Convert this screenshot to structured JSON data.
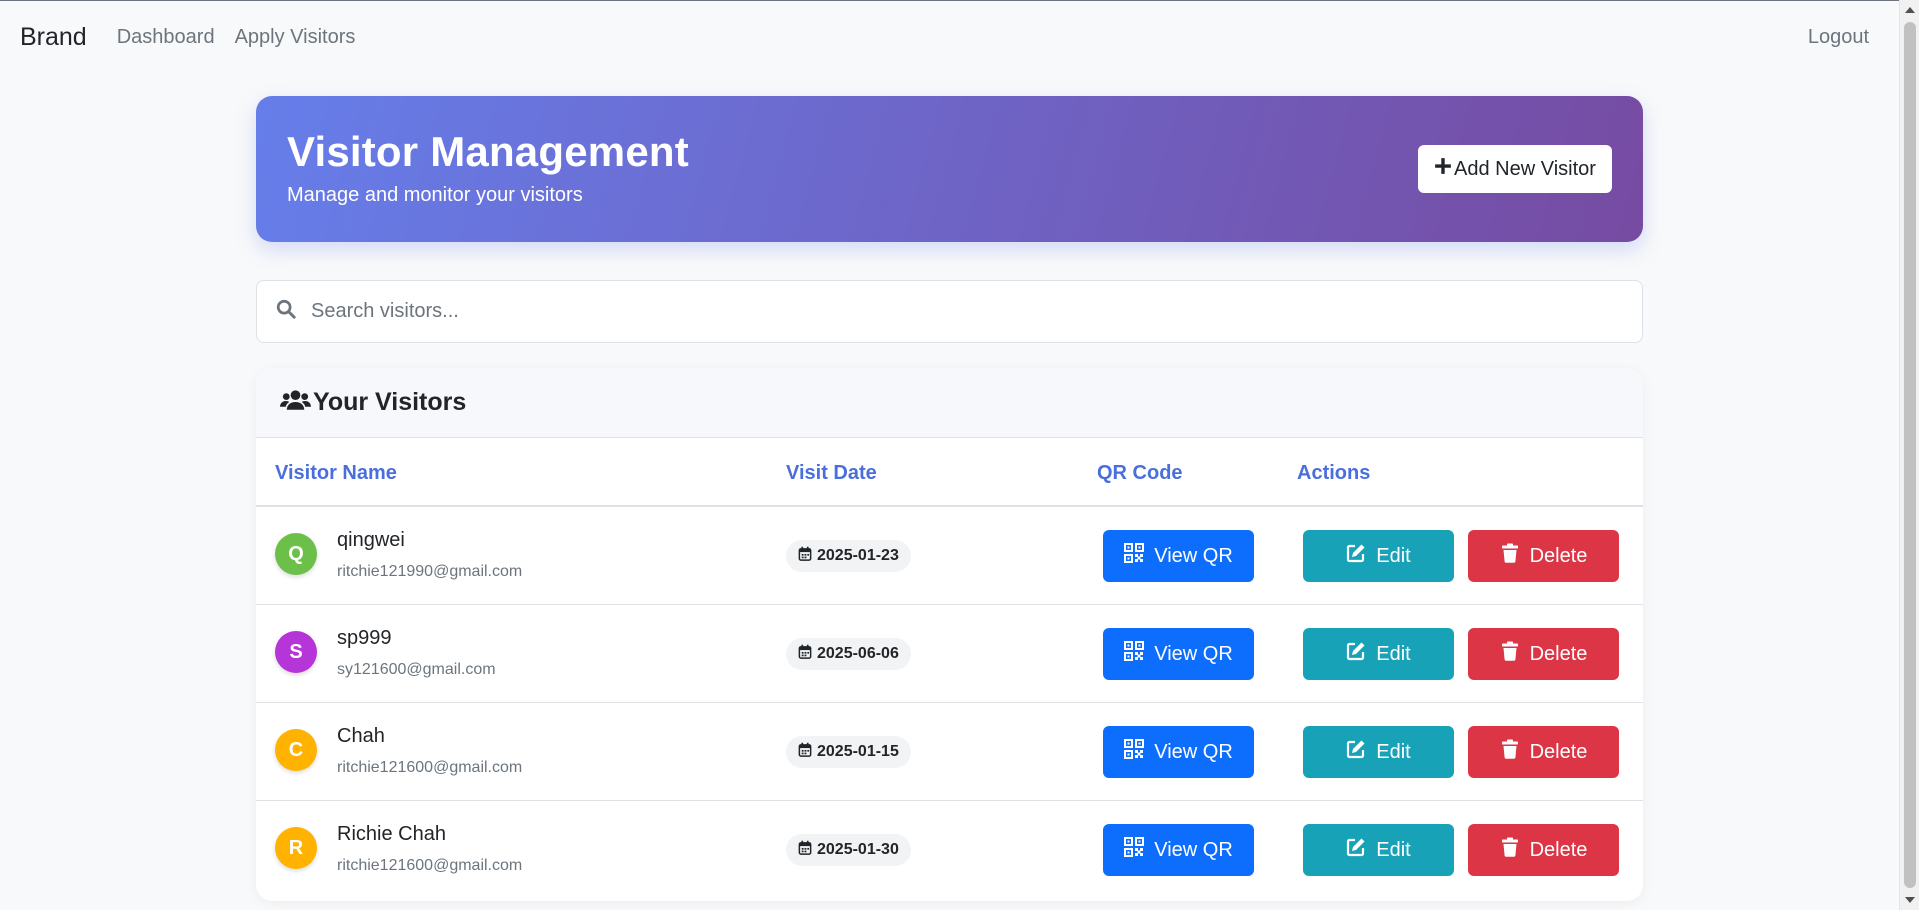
{
  "nav": {
    "brand": "Brand",
    "links": [
      "Dashboard",
      "Apply Visitors"
    ],
    "logout": "Logout"
  },
  "hero": {
    "title": "Visitor Management",
    "subtitle": "Manage and monitor your visitors",
    "add_button": "Add New Visitor",
    "gradient": [
      "#667eea",
      "#764ba2"
    ]
  },
  "search": {
    "placeholder": "Search visitors..."
  },
  "visitors_card": {
    "title": "Your Visitors",
    "columns": [
      "Visitor Name",
      "Visit Date",
      "QR Code",
      "Actions"
    ],
    "rows": [
      {
        "initial": "Q",
        "avatar_color": "#6cc04a",
        "name": "qingwei",
        "email": "ritchie121990@gmail.com",
        "date": "2025-01-23"
      },
      {
        "initial": "S",
        "avatar_color": "#b535d8",
        "name": "sp999",
        "email": "sy121600@gmail.com",
        "date": "2025-06-06"
      },
      {
        "initial": "C",
        "avatar_color": "#ffb300",
        "name": "Chah",
        "email": "ritchie121600@gmail.com",
        "date": "2025-01-15"
      },
      {
        "initial": "R",
        "avatar_color": "#ffb300",
        "name": "Richie Chah",
        "email": "ritchie121600@gmail.com",
        "date": "2025-01-30"
      }
    ],
    "buttons": {
      "qr": "View QR",
      "edit": "Edit",
      "delete": "Delete"
    }
  },
  "colors": {
    "qr_button": "#0d6efd",
    "edit_button": "#17a2b8",
    "delete_button": "#dc3545",
    "header_text": "#4a6fdc"
  },
  "icons": {
    "add": "plus-icon",
    "search": "search-icon",
    "card_header": "users-icon",
    "date": "calendar-icon",
    "qr": "qrcode-icon",
    "edit": "edit-icon",
    "delete": "trash-icon"
  }
}
